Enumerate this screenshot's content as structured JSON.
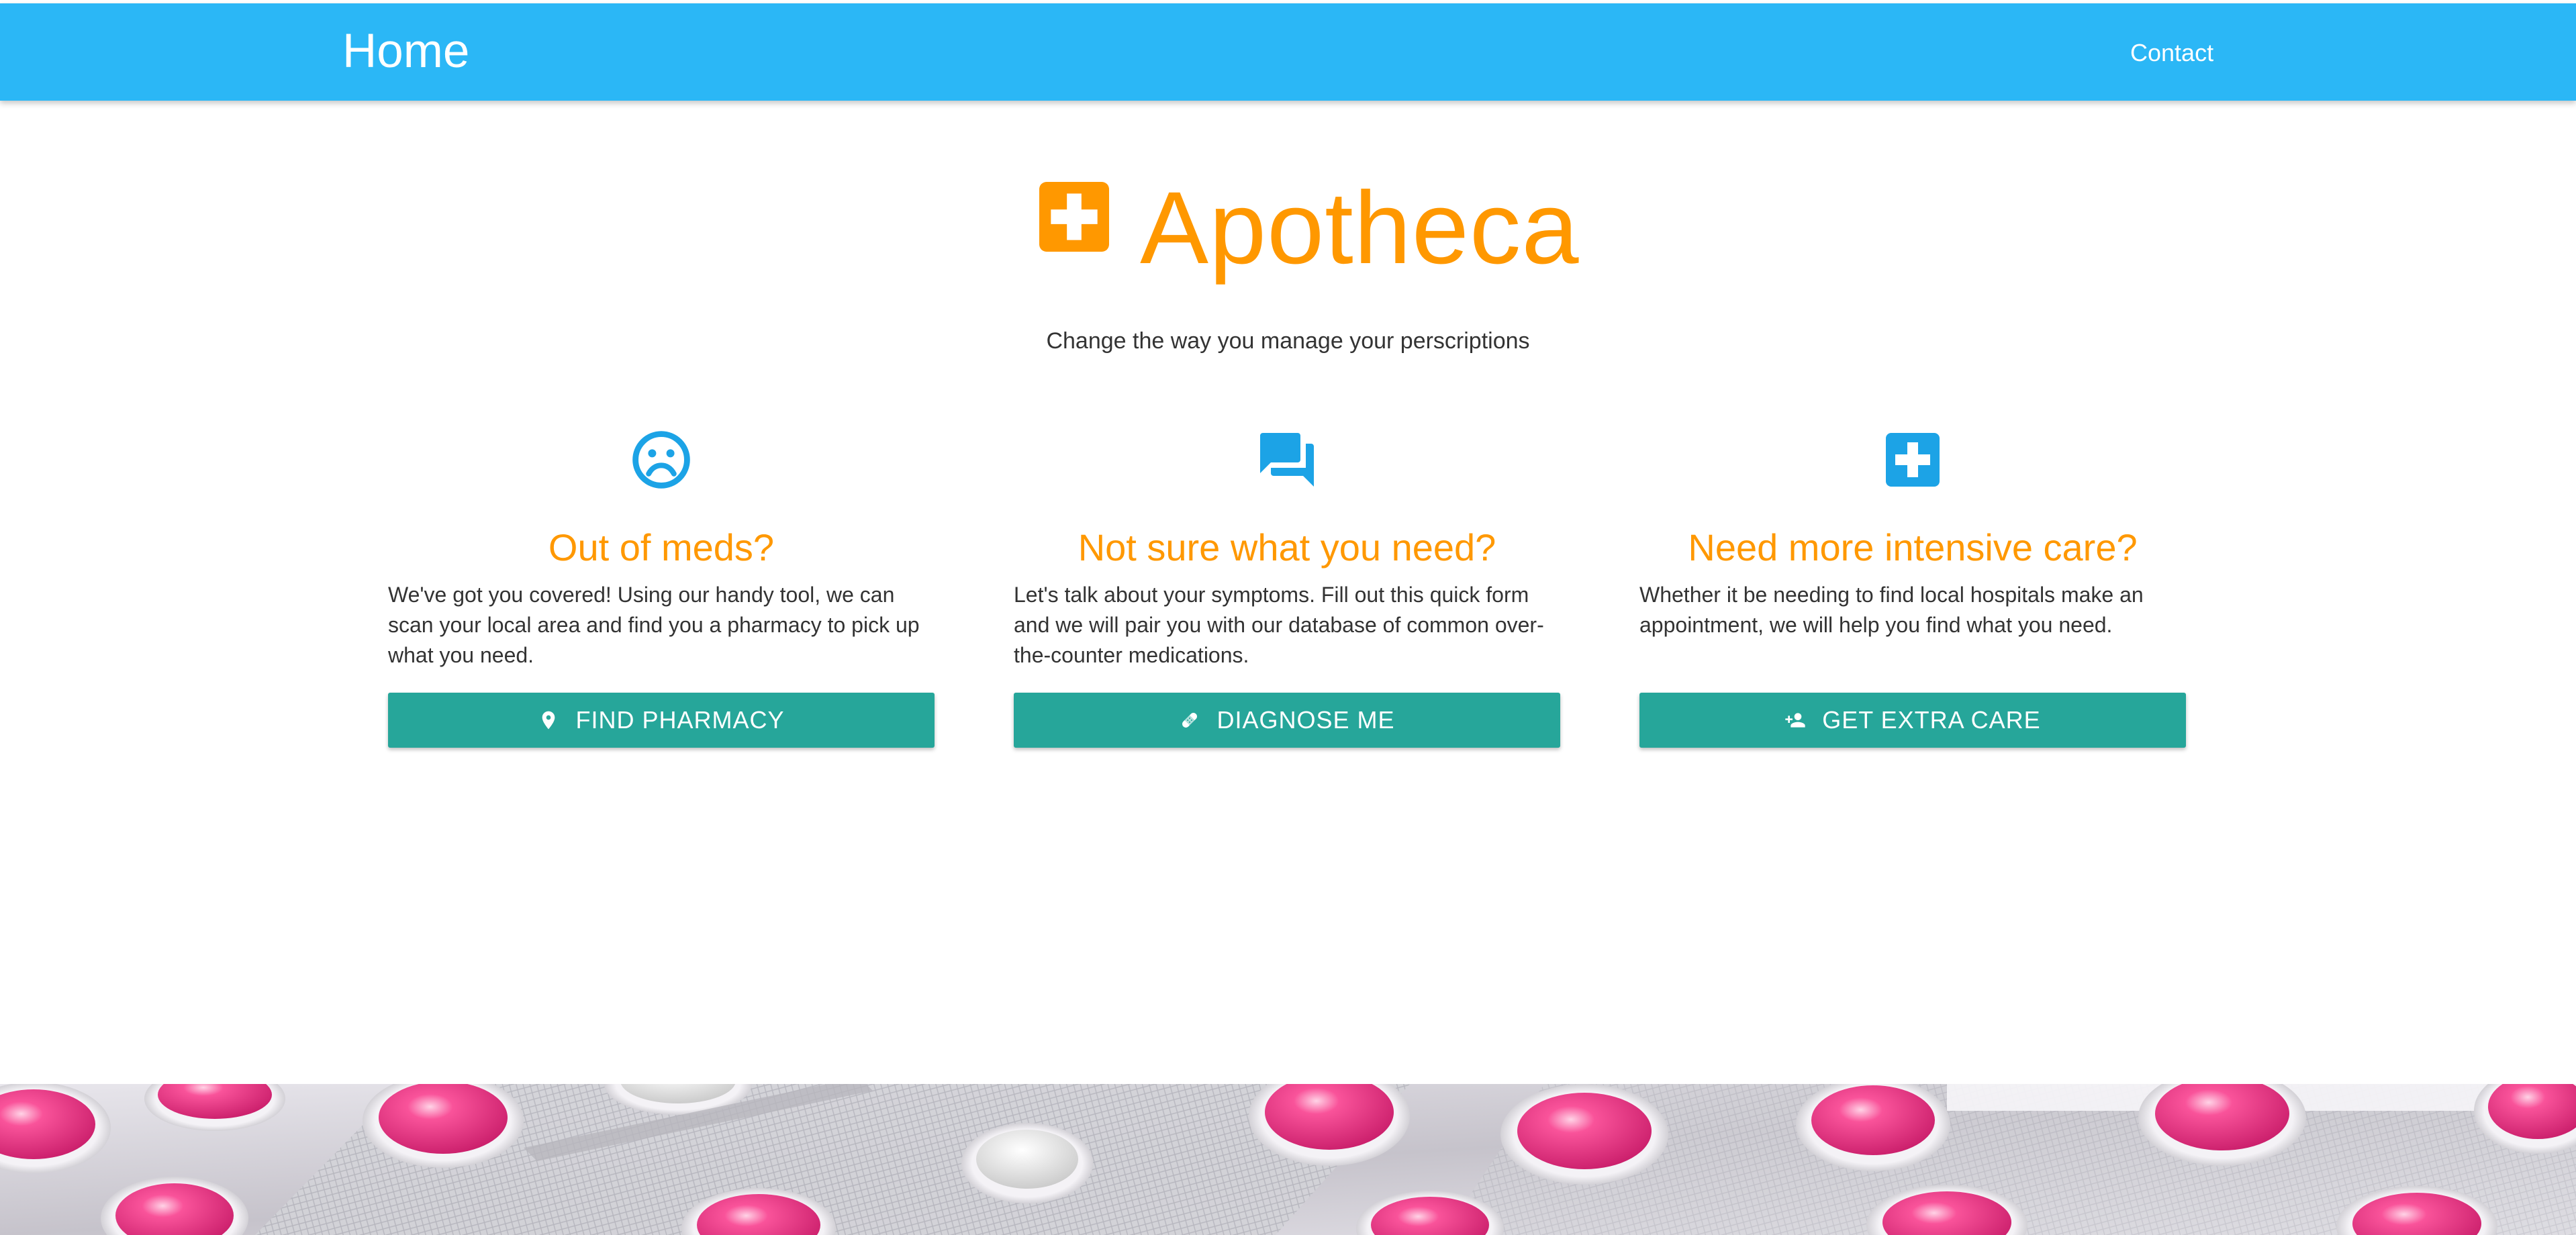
{
  "nav": {
    "brand": "Home",
    "contact": "Contact"
  },
  "hero": {
    "title": "Apotheca",
    "logo_icon": "medical-cross-icon",
    "tagline": "Change the way you manage your perscriptions"
  },
  "features": [
    {
      "icon": "sad-face-icon",
      "title": "Out of meds?",
      "text": "We've got you covered! Using our handy tool, we can scan your local area and find you a pharmacy to pick up what you need.",
      "button_icon": "location-pin-icon",
      "button": "FIND PHARMACY"
    },
    {
      "icon": "chat-bubbles-icon",
      "title": "Not sure what you need?",
      "text": "Let's talk about your symptoms. Fill out this quick form and we will pair you with our database of common over-the-counter medications.",
      "button_icon": "bandage-icon",
      "button": "DIAGNOSE ME"
    },
    {
      "icon": "medical-cross-icon",
      "title": "Need more intensive care?",
      "text": "Whether it be needing to find local hospitals make an appointment, we will help you find what you need.",
      "button_icon": "add-person-icon",
      "button": "GET EXTRA CARE"
    }
  ],
  "banner": {
    "image": "pink-pills-blister-pack-photo"
  },
  "colors": {
    "navbar": "#2bb7f6",
    "accent_orange": "#ff9800",
    "icon_blue": "#1ca3e6",
    "button_teal": "#26a69a"
  }
}
